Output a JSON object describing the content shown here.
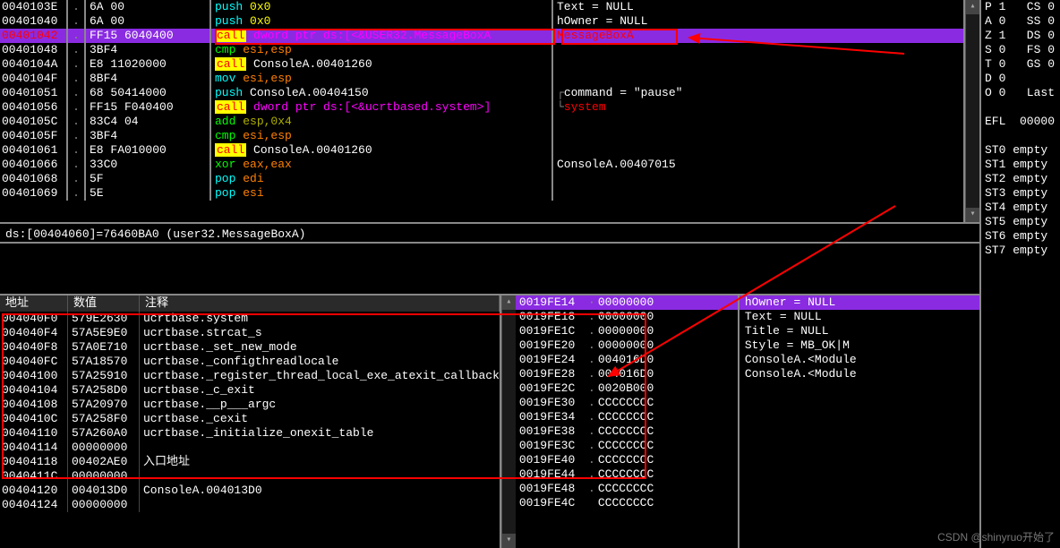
{
  "disasm": [
    {
      "addr": "0040103E",
      "dot": ".",
      "bytes": "6A 00",
      "mnem": "push",
      "mnemClass": "cyan",
      "ops": "0x0",
      "opsClass": "yellow",
      "cmt": "Text = NULL",
      "cmtClass": "white"
    },
    {
      "addr": "00401040",
      "dot": ".",
      "bytes": "6A 00",
      "mnem": "push",
      "mnemClass": "cyan",
      "ops": "0x0",
      "opsClass": "yellow",
      "cmt": "hOwner = NULL",
      "cmtClass": "white"
    },
    {
      "addr": "00401042",
      "addrClass": "red",
      "dot": ".",
      "bytes": "FF15 6040400",
      "mnem": "call",
      "mnemClass": "call-hl",
      "ops": "dword ptr ds:[<&USER32.MessageBoxA",
      "opsClass": "mag",
      "cmt": "MessageBoxA",
      "cmtClass": "red",
      "hl": true
    },
    {
      "addr": "00401048",
      "dot": ".",
      "bytes": "3BF4",
      "mnem": "cmp",
      "mnemClass": "green",
      "ops": "esi,esp",
      "opsClass": "orange",
      "cmt": "",
      "cmtClass": ""
    },
    {
      "addr": "0040104A",
      "dot": ".",
      "bytes": "E8 11020000",
      "mnem": "call",
      "mnemClass": "call-hl",
      "ops": "ConsoleA.00401260",
      "opsClass": "white",
      "cmt": "",
      "cmtClass": ""
    },
    {
      "addr": "0040104F",
      "dot": ".",
      "bytes": "8BF4",
      "mnem": "mov",
      "mnemClass": "cyan",
      "ops": "esi,esp",
      "opsClass": "orange",
      "cmt": "",
      "cmtClass": ""
    },
    {
      "addr": "00401051",
      "dot": ".",
      "bytes": "68 50414000",
      "mnem": "push",
      "mnemClass": "cyan",
      "ops": "ConsoleA.00404150",
      "opsClass": "white",
      "cmt": "command = \"pause\"",
      "cmtClass": "white",
      "cmtPrefix": "┌"
    },
    {
      "addr": "00401056",
      "dot": ".",
      "bytes": "FF15 F040400",
      "mnem": "call",
      "mnemClass": "call-hl",
      "ops": "dword ptr ds:[<&ucrtbased.system>]",
      "opsClass": "mag",
      "cmt": "system",
      "cmtClass": "red",
      "cmtPrefix": "└"
    },
    {
      "addr": "0040105C",
      "dot": ".",
      "bytes": "83C4 04",
      "mnem": "add",
      "mnemClass": "green",
      "ops": "esp,0x4",
      "opsClass": "dkyellow",
      "cmt": "",
      "cmtClass": ""
    },
    {
      "addr": "0040105F",
      "dot": ".",
      "bytes": "3BF4",
      "mnem": "cmp",
      "mnemClass": "green",
      "ops": "esi,esp",
      "opsClass": "orange",
      "cmt": "",
      "cmtClass": ""
    },
    {
      "addr": "00401061",
      "dot": ".",
      "bytes": "E8 FA010000",
      "mnem": "call",
      "mnemClass": "call-hl",
      "ops": "ConsoleA.00401260",
      "opsClass": "white",
      "cmt": "",
      "cmtClass": ""
    },
    {
      "addr": "00401066",
      "dot": ".",
      "bytes": "33C0",
      "mnem": "xor",
      "mnemClass": "green",
      "ops": "eax,eax",
      "opsClass": "orange",
      "cmt": "ConsoleA.00407015",
      "cmtClass": "white"
    },
    {
      "addr": "00401068",
      "dot": ".",
      "bytes": "5F",
      "mnem": "pop",
      "mnemClass": "cyan",
      "ops": "edi",
      "opsClass": "orange",
      "cmt": "",
      "cmtClass": ""
    },
    {
      "addr": "00401069",
      "dot": ".",
      "bytes": "5E",
      "mnem": "pop",
      "mnemClass": "cyan",
      "ops": "esi",
      "opsClass": "orange",
      "cmt": "",
      "cmtClass": ""
    }
  ],
  "info_line": "ds:[00404060]=76460BA0 (user32.MessageBoxA)",
  "dump_header": {
    "addr": "地址",
    "val": "数值",
    "cmt": "注释"
  },
  "dump": [
    {
      "addr": "004040F0",
      "val": "579E2630",
      "cmt": "ucrtbase.system"
    },
    {
      "addr": "004040F4",
      "val": "57A5E9E0",
      "cmt": "ucrtbase.strcat_s"
    },
    {
      "addr": "004040F8",
      "val": "57A0E710",
      "cmt": "ucrtbase._set_new_mode"
    },
    {
      "addr": "004040FC",
      "val": "57A18570",
      "cmt": "ucrtbase._configthreadlocale"
    },
    {
      "addr": "00404100",
      "val": "57A25910",
      "cmt": "ucrtbase._register_thread_local_exe_atexit_callback"
    },
    {
      "addr": "00404104",
      "val": "57A258D0",
      "cmt": "ucrtbase._c_exit"
    },
    {
      "addr": "00404108",
      "val": "57A20970",
      "cmt": "ucrtbase.__p___argc"
    },
    {
      "addr": "0040410C",
      "val": "57A258F0",
      "cmt": "ucrtbase._cexit"
    },
    {
      "addr": "00404110",
      "val": "57A260A0",
      "cmt": "ucrtbase._initialize_onexit_table"
    },
    {
      "addr": "00404114",
      "val": "00000000",
      "cmt": ""
    },
    {
      "addr": "00404118",
      "val": "00402AE0",
      "cmt": "入口地址"
    },
    {
      "addr": "0040411C",
      "val": "00000000",
      "cmt": ""
    },
    {
      "addr": "00404120",
      "val": "004013D0",
      "cmt": "ConsoleA.004013D0"
    },
    {
      "addr": "00404124",
      "val": "00000000",
      "cmt": ""
    }
  ],
  "stack": [
    {
      "addr": "0019FE14",
      "dot": "·",
      "val": "00000000",
      "hl": true
    },
    {
      "addr": "0019FE18",
      "dot": ".",
      "val": "00000000"
    },
    {
      "addr": "0019FE1C",
      "dot": ".",
      "val": "00000000"
    },
    {
      "addr": "0019FE20",
      "dot": ".",
      "val": "00000000"
    },
    {
      "addr": "0019FE24",
      "dot": ".",
      "val": "004016D0"
    },
    {
      "addr": "0019FE28",
      "dot": ".",
      "val": "004016D0"
    },
    {
      "addr": "0019FE2C",
      "dot": ".",
      "val": "0020B000"
    },
    {
      "addr": "0019FE30",
      "dot": ".",
      "val": "CCCCCCCC"
    },
    {
      "addr": "0019FE34",
      "dot": ".",
      "val": "CCCCCCCC"
    },
    {
      "addr": "0019FE38",
      "dot": ".",
      "val": "CCCCCCCC"
    },
    {
      "addr": "0019FE3C",
      "dot": ".",
      "val": "CCCCCCCC"
    },
    {
      "addr": "0019FE40",
      "dot": ".",
      "val": "CCCCCCCC"
    },
    {
      "addr": "0019FE44",
      "dot": ".",
      "val": "CCCCCCCC"
    },
    {
      "addr": "0019FE48",
      "dot": ".",
      "val": "CCCCCCCC"
    },
    {
      "addr": "0019FE4C",
      "dot": " ",
      "val": "CCCCCCCC"
    }
  ],
  "stack_cmt": [
    {
      "txt": "hOwner = NULL",
      "hl": true
    },
    {
      "txt": "Text = NULL"
    },
    {
      "txt": "Title = NULL"
    },
    {
      "txt": "Style = MB_OK|M"
    },
    {
      "txt": "ConsoleA.<Module"
    },
    {
      "txt": "ConsoleA.<Module"
    }
  ],
  "registers": [
    "P 1   CS 0",
    "A 0   SS 0",
    "Z 1   DS 0",
    "S 0   FS 0",
    "T 0   GS 0",
    "D 0",
    "O 0   Last",
    "",
    "EFL  00000",
    "",
    "ST0 empty",
    "ST1 empty",
    "ST2 empty",
    "ST3 empty",
    "ST4 empty",
    "ST5 empty",
    "ST6 empty",
    "ST7 empty"
  ],
  "watermark": "CSDN @shinyruo开始了"
}
